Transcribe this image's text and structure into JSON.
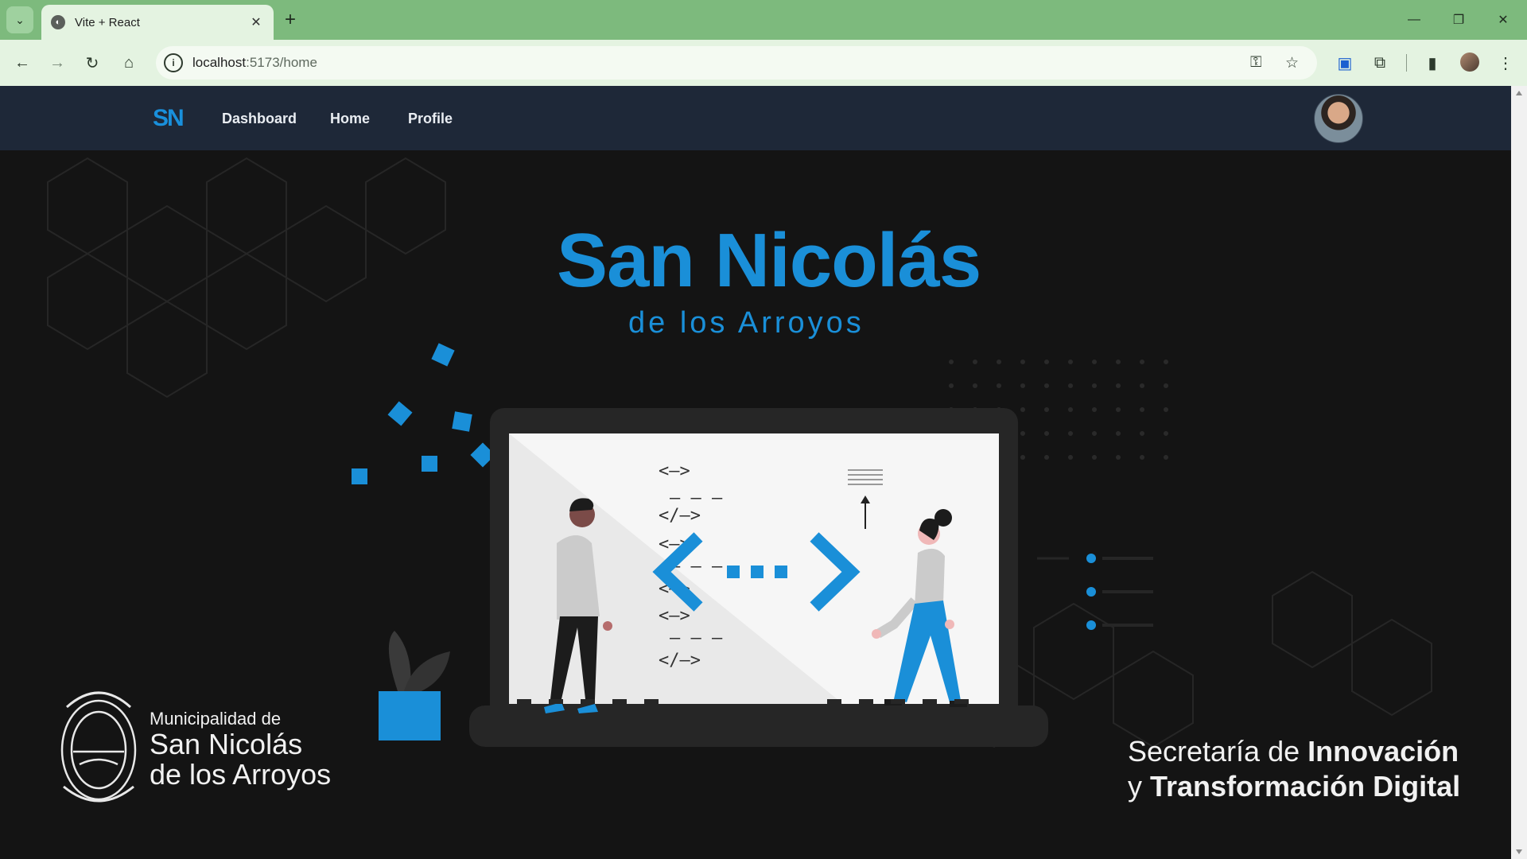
{
  "browser": {
    "tab_title": "Vite + React",
    "url_host": "localhost",
    "url_path": ":5173/home",
    "icons": [
      "tab-search-icon",
      "tab-favicon-icon",
      "close-icon",
      "plus-icon",
      "minimize-icon",
      "restore-icon",
      "close-window-icon",
      "back-icon",
      "forward-icon",
      "reload-icon",
      "home-icon",
      "info-icon",
      "key-icon",
      "star-icon",
      "cast-icon",
      "extensions-icon",
      "sidepanel-icon",
      "menu-icon"
    ]
  },
  "nav": {
    "brand": "SN",
    "links": [
      "Dashboard",
      "Home",
      "Profile"
    ]
  },
  "hero": {
    "logo_title": "San Nicolás",
    "logo_subtitle": "de los Arroyos",
    "municipality": {
      "line1": "Municipalidad de",
      "line2": "San Nicolás",
      "line3": "de los Arroyos"
    },
    "secretaria": {
      "prefix": "Secretaría de ",
      "bold1": "Innovación",
      "line2_prefix": "y ",
      "bold2": "Transformación Digital"
    },
    "code_lines": [
      "<—>",
      "— — —",
      "</—>",
      "<—>",
      "— — —",
      "<—>",
      "<—>",
      "— — —",
      "</—>"
    ]
  },
  "colors": {
    "accent": "#1a8fd8",
    "nav_bg": "#1e2838",
    "page_bg": "#141414",
    "tab_strip": "#7dba7d"
  }
}
